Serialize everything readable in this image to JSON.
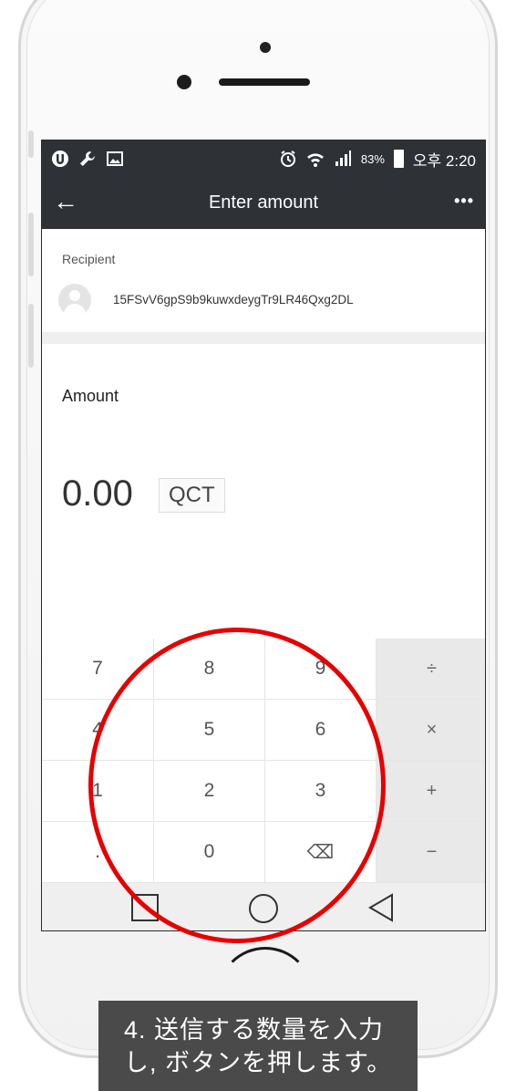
{
  "status_bar": {
    "left_icons": [
      "app-icon",
      "wrench-icon",
      "image-icon"
    ],
    "right_icons": [
      "alarm-icon",
      "wifi-icon",
      "signal-icon"
    ],
    "battery": "83%",
    "time": "오후 2:20"
  },
  "app_bar": {
    "back": "←",
    "title": "Enter amount",
    "more": "•••"
  },
  "recipient": {
    "label": "Recipient",
    "address": "15FSvV6gpS9b9kuwxdeygTr9LR46Qxg2DL"
  },
  "amount": {
    "label": "Amount",
    "value": "0.00",
    "currency": "QCT"
  },
  "keypad": {
    "rows": [
      [
        "7",
        "8",
        "9",
        "÷"
      ],
      [
        "4",
        "5",
        "6",
        "×"
      ],
      [
        "1",
        "2",
        "3",
        "+"
      ],
      [
        ".",
        "0",
        "⌫",
        "−"
      ]
    ]
  },
  "caption": {
    "line1": "4. 送信する数量を入力",
    "line2": "し, ボタンを押します。"
  },
  "colors": {
    "header": "#2e3237",
    "annotation": "#e60000",
    "caption_bg": "#4a4a4a"
  }
}
